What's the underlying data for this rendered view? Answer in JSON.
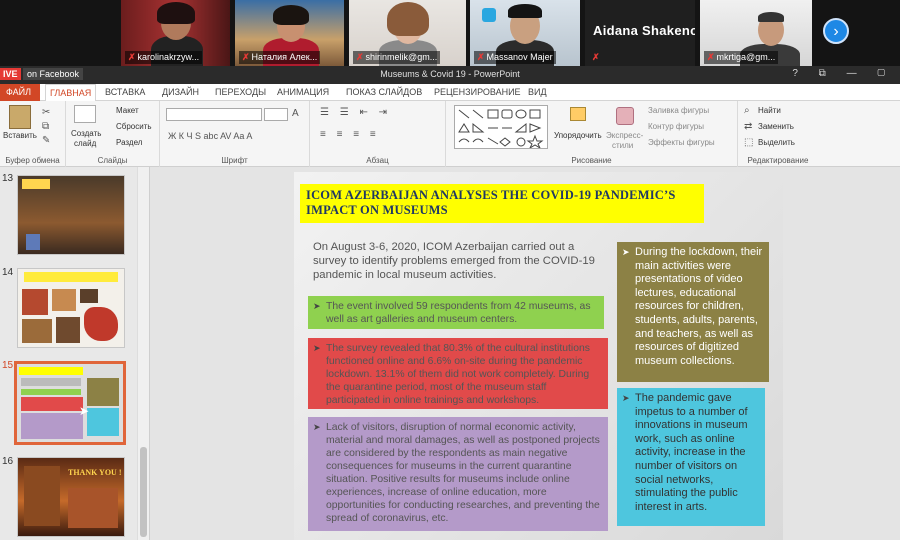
{
  "video_tiles": [
    {
      "name": "karolinakrzyw...",
      "muted": true
    },
    {
      "name": "Наталия Алек...",
      "muted": true
    },
    {
      "name": "shirinmelik@gm...",
      "muted": true
    },
    {
      "name": "Massanov Majer",
      "muted": true
    },
    {
      "name": "Aidana  Shakeno...",
      "muted": true
    },
    {
      "name": "mkrtiga@gm...",
      "muted": true
    }
  ],
  "next_button_icon": "chevron-right-icon",
  "titlebar": {
    "live_label": "IVE",
    "on_facebook": "on Facebook",
    "title": "Museums & Covid 19 - PowerPoint",
    "icons": "?  ⧉  —  ▢"
  },
  "tabs": [
    "ФАЙЛ",
    "ГЛАВНАЯ",
    "ВСТАВКА",
    "ДИЗАЙН",
    "ПЕРЕХОДЫ",
    "АНИМАЦИЯ",
    "ПОКАЗ СЛАЙДОВ",
    "РЕЦЕНЗИРОВАНИЕ",
    "ВИД"
  ],
  "ribbon": {
    "clipboard": {
      "label": "Буфер обмена",
      "paste": "Вставить"
    },
    "slides": {
      "label": "Слайды",
      "create": "Создать",
      "create2": "слайд",
      "layout": "Макет",
      "reset": "Сбросить",
      "section": "Раздел"
    },
    "font": {
      "label": "Шрифт",
      "buttons": "Ж  К  Ч  S  abc  AV  Aa  A"
    },
    "paragraph": {
      "label": "Абзац"
    },
    "drawing": {
      "label": "Рисование",
      "arrange": "Упорядочить",
      "quick_styles": "Экспресс-",
      "quick_styles2": "стили",
      "fill": "Заливка фигуры",
      "outline": "Контур фигуры",
      "effects": "Эффекты фигуры"
    },
    "editing": {
      "label": "Редактирование",
      "find": "Найти",
      "replace": "Заменить",
      "select": "Выделить"
    }
  },
  "thumbnails": [
    {
      "num": "13",
      "selected": false
    },
    {
      "num": "14",
      "selected": false
    },
    {
      "num": "15",
      "selected": true
    },
    {
      "num": "16",
      "selected": false,
      "text": "THANK YOU !"
    }
  ],
  "slide": {
    "title": "ICOM AZERBAIJAN ANALYSES THE COVID-19 PANDEMIC’S IMPACT ON MUSEUMS",
    "intro": "On August 3-6, 2020, ICOM Azerbaijan carried out a survey to identify problems emerged from the COVID-19 pandemic in local museum activities.",
    "box1": "The event involved 59 respondents from 42 museums, as well as art galleries and museum centers.",
    "box2": "The survey revealed that 80.3% of the cultural institutions functioned online and 6.6% on-site during the pandemic lockdown. 13.1% of them did not work completely. During the quarantine period, most of the museum staff participated in online trainings and workshops.",
    "box3": "Lack of visitors, disruption of normal economic activity, material and moral damages, as well as postponed projects are considered by the respondents as  main negative consequences for museums in the current quarantine situation. Positive results for museums include online experiences, increase of online education, more opportunities for conducting researches, and preventing the spread of coronavirus, etc.",
    "right1": "During the lockdown, their main activities were presentations of video lectures, educational resources for children, students, adults, parents, and teachers, as well as resources of digitized museum collections.",
    "right2": "The pandemic gave impetus to a number of innovations in museum work, such as online activity, increase in the number of visitors on social networks, stimulating the public interest in arts.",
    "bullet_glyph": "➤"
  },
  "colors": {
    "accent": "#d24726",
    "title_bg": "#ffff00",
    "green": "#8fd14f",
    "red": "#e14a4a",
    "purple": "#b49ac9",
    "olive": "#8c8145",
    "cyan": "#4ec6de"
  }
}
